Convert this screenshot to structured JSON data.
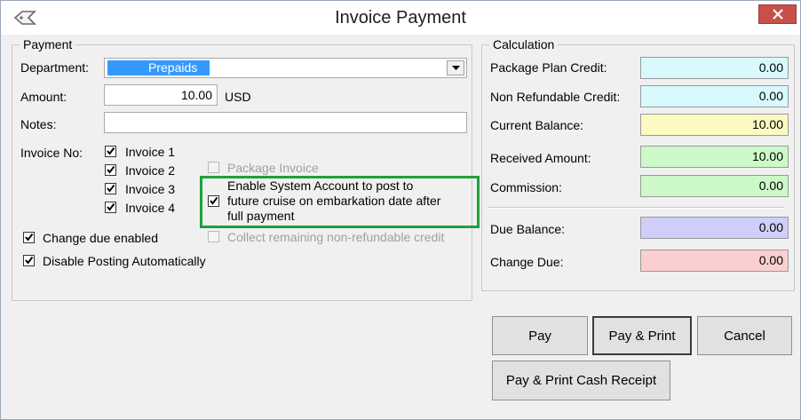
{
  "window": {
    "title": "Invoice Payment"
  },
  "payment": {
    "legend": "Payment",
    "department_label": "Department:",
    "department_value": "Prepaids",
    "amount_label": "Amount:",
    "amount_value": "10.00",
    "currency": "USD",
    "notes_label": "Notes:",
    "notes_value": "",
    "invoice_no_label": "Invoice No:",
    "invoices": [
      {
        "label": "Invoice 1",
        "checked": true
      },
      {
        "label": "Invoice 2",
        "checked": true
      },
      {
        "label": "Invoice 3",
        "checked": true
      },
      {
        "label": "Invoice 4",
        "checked": true
      }
    ],
    "package_invoice": {
      "label": "Package Invoice",
      "checked": false,
      "enabled": false
    },
    "enable_system_account": {
      "line1": "Enable System Account to post to",
      "line2": "future cruise on embarkation date after",
      "line3": "full payment",
      "checked": true
    },
    "collect_remaining": {
      "label": "Collect remaining non-refundable credit",
      "checked": false,
      "enabled": false
    },
    "change_due_enabled": {
      "label": "Change due enabled",
      "checked": true
    },
    "disable_posting": {
      "label": "Disable Posting Automatically",
      "checked": true
    }
  },
  "calculation": {
    "legend": "Calculation",
    "rows": [
      {
        "label": "Package Plan Credit:",
        "value": "0.00",
        "color": "#d8fafe"
      },
      {
        "label": "Non Refundable Credit:",
        "value": "0.00",
        "color": "#d8fafe"
      },
      {
        "label": "Current Balance:",
        "value": "10.00",
        "color": "#fdf9c2"
      },
      {
        "label": "Received Amount:",
        "value": "10.00",
        "color": "#cdf9c8"
      },
      {
        "label": "Commission:",
        "value": "0.00",
        "color": "#cdf9c8"
      },
      {
        "label": "Due Balance:",
        "value": "0.00",
        "color": "#cfcef8"
      },
      {
        "label": "Change Due:",
        "value": "0.00",
        "color": "#fbcfcf"
      }
    ]
  },
  "buttons": {
    "pay": "Pay",
    "pay_print": "Pay & Print",
    "cancel": "Cancel",
    "pay_print_cash_receipt": "Pay & Print Cash Receipt"
  },
  "icons": {
    "app": "diamond-tag-icon",
    "close": "close-icon",
    "dropdown": "chevron-down-icon",
    "check": "check-icon"
  }
}
